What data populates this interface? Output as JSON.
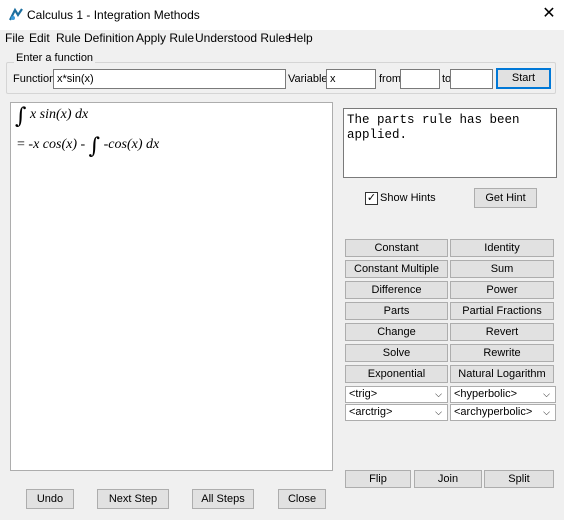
{
  "window": {
    "title": "Calculus 1 - Integration Methods",
    "close_glyph": "✕",
    "app_icon": "calculator-app-icon"
  },
  "menu": [
    "File",
    "Edit",
    "Rule Definition",
    "Apply Rule",
    "Understood Rules",
    "Help"
  ],
  "function_group": {
    "legend": "Enter a function",
    "function_label": "Function",
    "function_value": "x*sin(x)",
    "variable_label": "Variable",
    "variable_value": "x",
    "from_label": "from",
    "from_value": "",
    "to_label": "to",
    "to_value": "",
    "start_label": "Start"
  },
  "workspace": {
    "line1": {
      "integral": "∫",
      "integrand": "x sin(x) dx"
    },
    "line2": {
      "eq": "=",
      "part1": "-x cos(x) -",
      "integral": "∫",
      "integrand": "-cos(x) dx"
    }
  },
  "hints": {
    "text": "The parts rule has been applied.",
    "show_hints_label": "Show Hints",
    "show_hints_checked": true,
    "get_hint_label": "Get Hint"
  },
  "rules": [
    [
      "Constant",
      "Identity"
    ],
    [
      "Constant Multiple",
      "Sum"
    ],
    [
      "Difference",
      "Power"
    ],
    [
      "Parts",
      "Partial Fractions"
    ],
    [
      "Change",
      "Revert"
    ],
    [
      "Solve",
      "Rewrite"
    ],
    [
      "Exponential",
      "Natural Logarithm"
    ]
  ],
  "selects": [
    [
      "<trig>",
      "<hyperbolic>"
    ],
    [
      "<arctrig>",
      "<archyperbolic>"
    ]
  ],
  "tree_buttons": {
    "flip": "Flip",
    "join": "Join",
    "split": "Split"
  },
  "bottom_buttons": {
    "undo": "Undo",
    "next_step": "Next Step",
    "all_steps": "All Steps",
    "close": "Close"
  }
}
